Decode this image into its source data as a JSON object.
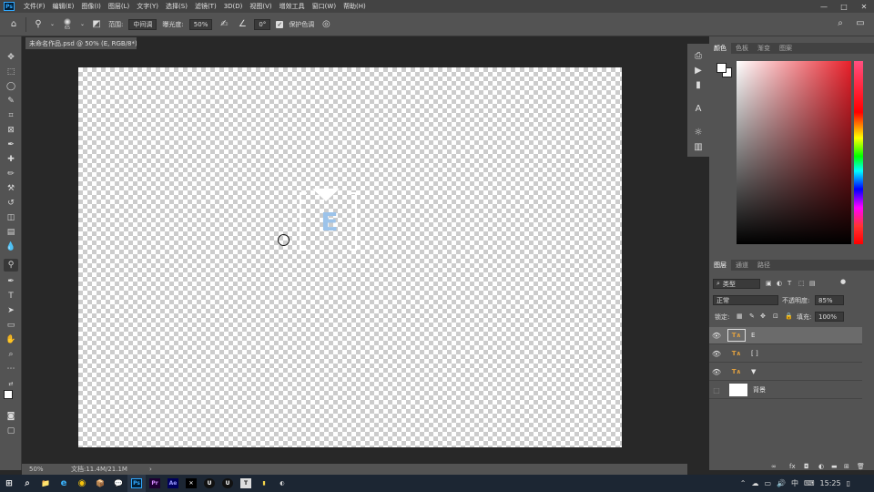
{
  "app": {
    "logo": "Ps"
  },
  "menubar": {
    "items": [
      "文件(F)",
      "编辑(E)",
      "图像(I)",
      "图层(L)",
      "文字(Y)",
      "选择(S)",
      "滤镜(T)",
      "3D(D)",
      "视图(V)",
      "增效工具",
      "窗口(W)",
      "帮助(H)"
    ],
    "win_controls": [
      "—",
      "□",
      "✕"
    ]
  },
  "options_bar": {
    "brush_size": "65",
    "range_label": "范围:",
    "range_value": "中间调",
    "exposure_label": "曝光度:",
    "exposure_value": "50%",
    "angle_value": "0°",
    "protect_tones_label": "保护色调"
  },
  "document": {
    "tab_title": "未命名作品.psd @ 50% (E, RGB/8*)",
    "tab_close": "×",
    "canvas_letter": "E"
  },
  "status": {
    "zoom": "50%",
    "doc_info": "文档:11.4M/21.1M",
    "arrow": "›"
  },
  "color_panel": {
    "tabs": [
      "颜色",
      "色板",
      "渐变",
      "图案"
    ]
  },
  "layers_panel": {
    "tabs": [
      "图层",
      "通道",
      "路径"
    ],
    "filter_label": "类型",
    "blend_mode": "正常",
    "opacity_label": "不透明度:",
    "opacity_value": "85%",
    "lock_label": "锁定:",
    "fill_label": "填充:",
    "fill_value": "100%",
    "layers": [
      {
        "name": "E",
        "visible": true
      },
      {
        "name": "[ ]",
        "visible": true
      },
      {
        "name": "▼",
        "visible": true
      },
      {
        "name": "背景",
        "visible": false
      }
    ]
  },
  "taskbar": {
    "apps": [
      "⊞",
      "⌕",
      "📁",
      "e",
      "◉",
      "📦",
      "💬",
      "Ps",
      "Pr",
      "Ae",
      "✕",
      "U",
      "U",
      "T",
      "▮",
      "◐"
    ],
    "tray": {
      "ime": "中",
      "clock": "15:25"
    }
  },
  "colors": {
    "accent": "#31a8ff",
    "selection": "#6b6b6b",
    "panel": "#535353"
  }
}
